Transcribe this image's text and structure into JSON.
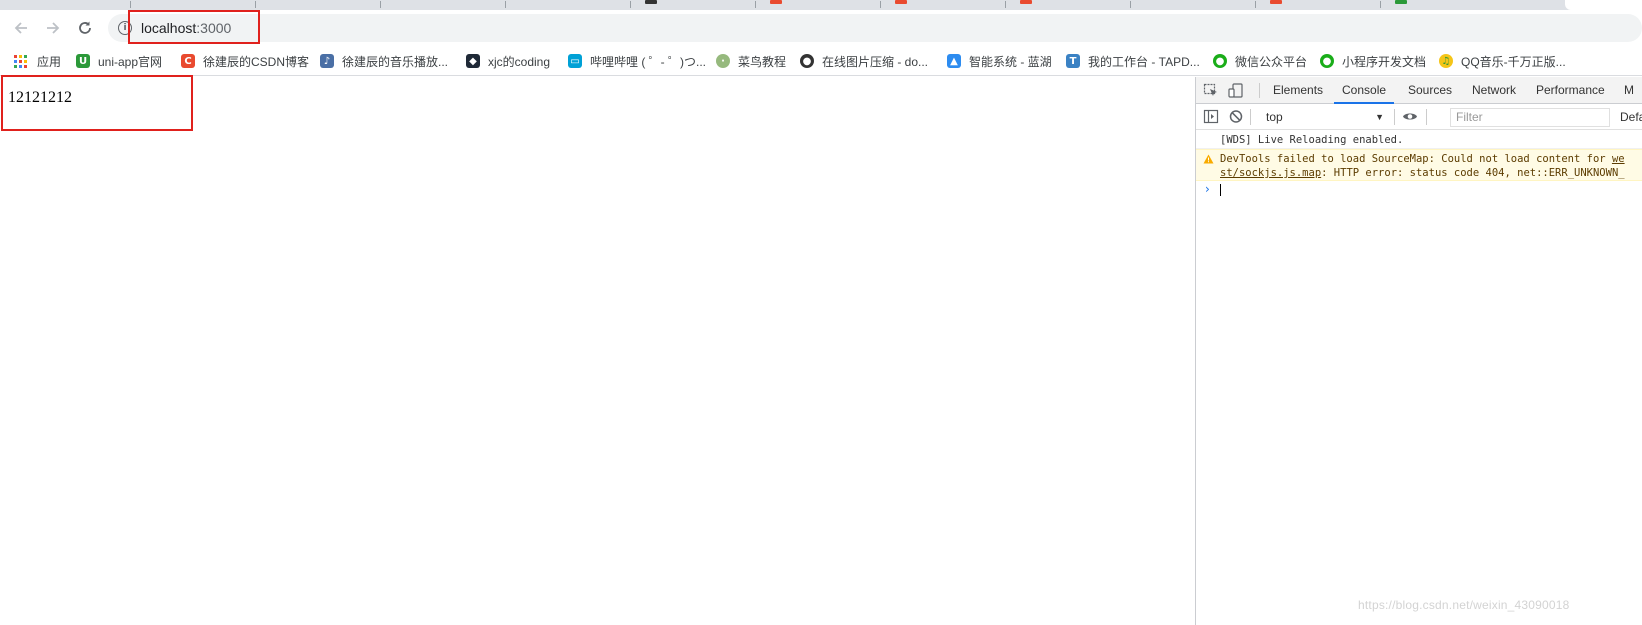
{
  "browser": {
    "address_bar": {
      "host": "localhost",
      "port": ":3000"
    },
    "bookmarks": [
      {
        "label": "应用",
        "icon": "apps-grid-icon"
      },
      {
        "label": "uni-app官网",
        "icon": "uniapp-icon",
        "color": "#2b9939"
      },
      {
        "label": "徐建辰的CSDN博客",
        "icon": "csdn-icon",
        "color": "#e94a2f"
      },
      {
        "label": "徐建辰的音乐播放...",
        "icon": "music-icon",
        "color": "#4a6fa5"
      },
      {
        "label": "xjc的coding",
        "icon": "coding-icon",
        "color": "#1f2937"
      },
      {
        "label": "哔哩哔哩 ( ゜- ゜)つ...",
        "icon": "bilibili-icon",
        "color": "#00a1d6"
      },
      {
        "label": "菜鸟教程",
        "icon": "runoob-icon",
        "color": "#96b97d"
      },
      {
        "label": "在线图片压缩 - do...",
        "icon": "compress-icon",
        "color": "#333333"
      },
      {
        "label": "智能系统 - 蓝湖",
        "icon": "lanhu-icon",
        "color": "#2d8cf0"
      },
      {
        "label": "我的工作台 - TAPD...",
        "icon": "tapd-icon",
        "color": "#3b82c4"
      },
      {
        "label": "微信公众平台",
        "icon": "wechat-icon",
        "color": "#1aad19"
      },
      {
        "label": "小程序开发文档",
        "icon": "wechat-icon",
        "color": "#1aad19"
      },
      {
        "label": "QQ音乐-千万正版...",
        "icon": "qqmusic-icon",
        "color": "#f5c518"
      }
    ]
  },
  "page": {
    "content_text": "12121212"
  },
  "devtools": {
    "tabs": [
      "Elements",
      "Console",
      "Sources",
      "Network",
      "Performance",
      "M"
    ],
    "active_tab": "Console",
    "context": "top",
    "filter_placeholder": "Filter",
    "levels_label": "Defa",
    "messages": [
      {
        "type": "log",
        "text": "[WDS] Live Reloading enabled."
      },
      {
        "type": "warning",
        "line1": "DevTools failed to load SourceMap: Could not load content for ",
        "link1": "we",
        "link2": "st/sockjs.js.map",
        "line2": ": HTTP error: status code 404, net::ERR_UNKNOWN_"
      }
    ]
  },
  "watermark": "https://blog.csdn.net/weixin_43090018",
  "colors": {
    "highlight_box": "#e0211d",
    "devtools_accent": "#1a73e8",
    "warning_bg": "#fffbe5"
  }
}
